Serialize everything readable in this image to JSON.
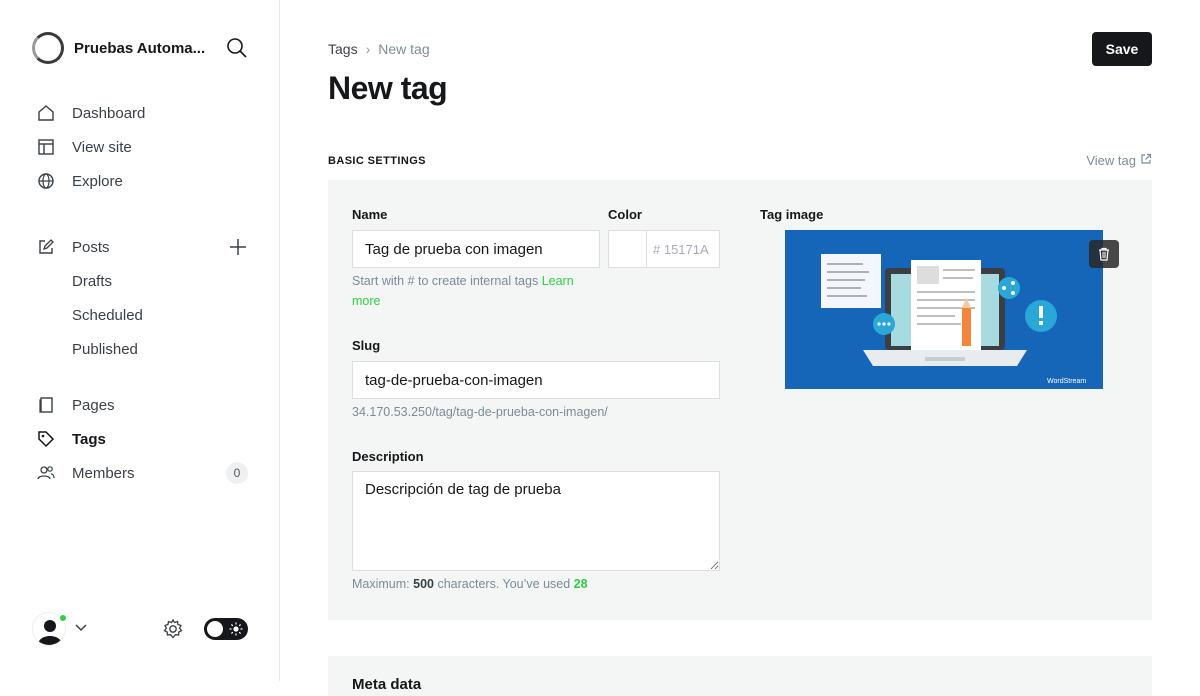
{
  "sidebar": {
    "site_name": "Pruebas Automa...",
    "nav_main": [
      {
        "label": "Dashboard",
        "icon": "home-icon"
      },
      {
        "label": "View site",
        "icon": "layout-icon"
      },
      {
        "label": "Explore",
        "icon": "globe-icon"
      }
    ],
    "posts": {
      "label": "Posts",
      "icon": "edit-icon"
    },
    "posts_sub": [
      "Drafts",
      "Scheduled",
      "Published"
    ],
    "nav_content": [
      {
        "label": "Pages",
        "icon": "page-icon"
      },
      {
        "label": "Tags",
        "icon": "tag-icon",
        "active": true
      },
      {
        "label": "Members",
        "icon": "members-icon",
        "badge": "0"
      }
    ]
  },
  "header": {
    "breadcrumb_parent": "Tags",
    "breadcrumb_current": "New tag",
    "title": "New tag",
    "save_label": "Save"
  },
  "basic_settings": {
    "section_label": "BASIC SETTINGS",
    "view_tag_label": "View tag",
    "name": {
      "label": "Name",
      "value": "Tag de prueba con imagen",
      "hint_prefix": "Start with # to create internal tags ",
      "hint_link": "Learn more"
    },
    "color": {
      "label": "Color",
      "placeholder": "# 15171A"
    },
    "slug": {
      "label": "Slug",
      "value": "tag-de-prueba-con-imagen",
      "url_preview": "34.170.53.250/tag/tag-de-prueba-con-imagen/"
    },
    "description": {
      "label": "Description",
      "value": "Descripción de tag de prueba",
      "hint_prefix": "Maximum: ",
      "max": "500",
      "hint_middle": " characters. You’ve used ",
      "used": "28"
    },
    "tag_image": {
      "label": "Tag image",
      "brand_mark": "WordStream"
    }
  },
  "metadata": {
    "heading": "Meta data"
  },
  "colors": {
    "accent": "#30cf43",
    "dark": "#15171a",
    "image_bg": "#1566b8"
  }
}
